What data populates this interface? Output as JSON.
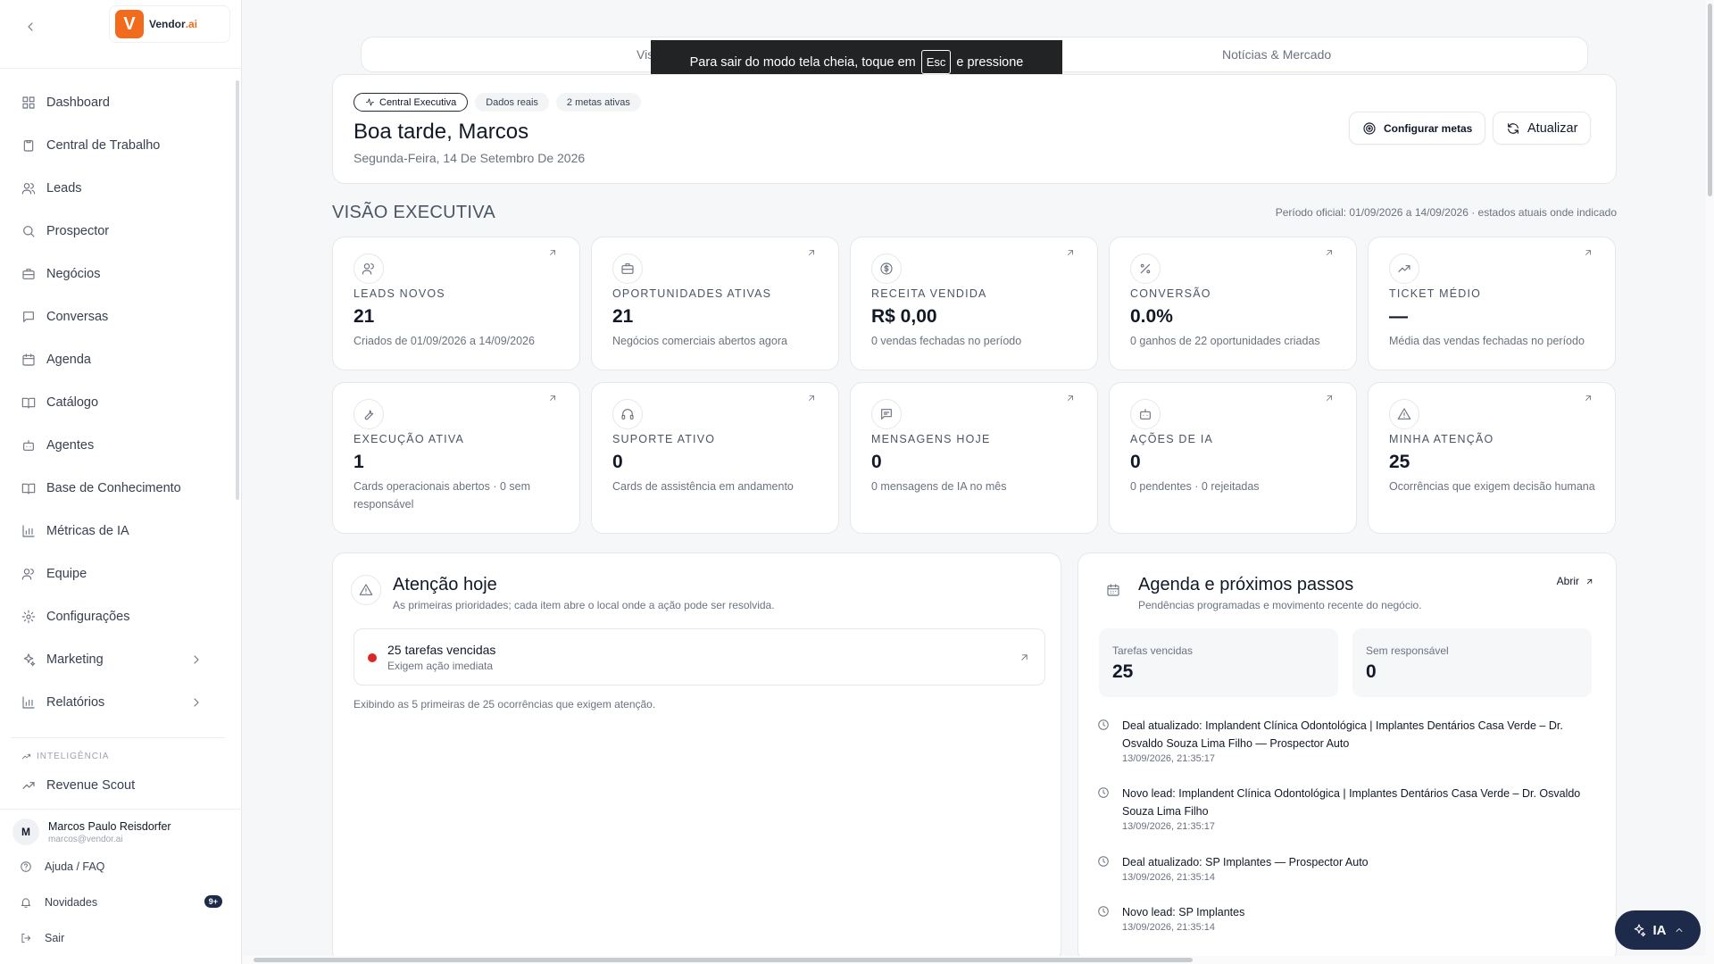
{
  "app": {
    "logo_letter": "V",
    "logo_name": "Vendor",
    "logo_suffix": ".ai",
    "accent": "#f26b1d",
    "dark": "#1e2a4a"
  },
  "sidebar": {
    "items": [
      {
        "label": "Dashboard",
        "icon": "grid-icon"
      },
      {
        "label": "Central de Trabalho",
        "icon": "clipboard-icon"
      },
      {
        "label": "Leads",
        "icon": "users-icon"
      },
      {
        "label": "Prospector",
        "icon": "search-icon"
      },
      {
        "label": "Negócios",
        "icon": "briefcase-icon"
      },
      {
        "label": "Conversas",
        "icon": "message-icon"
      },
      {
        "label": "Agenda",
        "icon": "calendar-icon"
      },
      {
        "label": "Catálogo",
        "icon": "book-icon"
      },
      {
        "label": "Agentes",
        "icon": "bot-icon"
      },
      {
        "label": "Base de Conhecimento",
        "icon": "book-open-icon"
      },
      {
        "label": "Métricas de IA",
        "icon": "bar-chart-icon"
      },
      {
        "label": "Equipe",
        "icon": "team-icon"
      },
      {
        "label": "Configurações",
        "icon": "gear-icon"
      },
      {
        "label": "Marketing",
        "icon": "sparkles-icon"
      },
      {
        "label": "Relatórios",
        "icon": "bar-chart-icon"
      }
    ],
    "section_label": "INTELIGÊNCIA",
    "revenue_scout": "Revenue Scout",
    "user": {
      "initial": "M",
      "name": "Marcos Paulo Reisdorfer",
      "email": "marcos@vendor.ai"
    },
    "help": "Ajuda / FAQ",
    "news": "Novidades",
    "news_badge": "9+",
    "logout": "Sair"
  },
  "tabs": {
    "first": "Visão",
    "second": "Notícias & Mercado"
  },
  "toast": {
    "before": "Para sair do modo tela cheia, toque em",
    "key": "Esc",
    "after": "e pressione"
  },
  "hero": {
    "chip_executive": "Central Executiva",
    "chip_data": "Dados reais",
    "chip_goals": "2 metas ativas",
    "greeting": "Boa tarde, Marcos",
    "date": "Segunda-Feira, 14 De Setembro De 2026",
    "configure_label": "Configurar metas",
    "refresh_label": "Atualizar"
  },
  "section": {
    "title": "VISÃO EXECUTIVA",
    "period": "Período oficial: 01/09/2026 a 14/09/2026 · estados atuais onde indicado"
  },
  "kpis": [
    {
      "label": "LEADS NOVOS",
      "value": "21",
      "desc": "Criados de 01/09/2026 a 14/09/2026",
      "icon": "users-icon"
    },
    {
      "label": "OPORTUNIDADES ATIVAS",
      "value": "21",
      "desc": "Negócios comerciais abertos agora",
      "icon": "briefcase-icon"
    },
    {
      "label": "RECEITA VENDIDA",
      "value": "R$ 0,00",
      "desc": "0 vendas fechadas no período",
      "icon": "dollar-icon"
    },
    {
      "label": "CONVERSÃO",
      "value": "0.0%",
      "desc": "0 ganhos de 22 oportunidades criadas",
      "icon": "percent-icon"
    },
    {
      "label": "TICKET MÉDIO",
      "value": "—",
      "desc": "Média das vendas fechadas no período",
      "icon": "trending-up-icon"
    },
    {
      "label": "EXECUÇÃO ATIVA",
      "value": "1",
      "desc": "Cards operacionais abertos · 0 sem responsável",
      "icon": "wrench-icon"
    },
    {
      "label": "SUPORTE ATIVO",
      "value": "0",
      "desc": "Cards de assistência em andamento",
      "icon": "headphones-icon"
    },
    {
      "label": "MENSAGENS HOJE",
      "value": "0",
      "desc": "0 mensagens de IA no mês",
      "icon": "message-square-icon"
    },
    {
      "label": "AÇÕES DE IA",
      "value": "0",
      "desc": "0 pendentes · 0 rejeitadas",
      "icon": "bot-icon"
    },
    {
      "label": "MINHA ATENÇÃO",
      "value": "25",
      "desc": "Ocorrências que exigem decisão humana",
      "icon": "alert-triangle-icon"
    }
  ],
  "attention": {
    "title": "Atenção hoje",
    "subtitle": "As primeiras prioridades; cada item abre o local onde a ação pode ser resolvida.",
    "item_title": "25 tarefas vencidas",
    "item_sub": "Exigem ação imediata",
    "footer": "Exibindo as 5 primeiras de 25 ocorrências que exigem atenção."
  },
  "agenda": {
    "title": "Agenda e próximos passos",
    "subtitle": "Pendências programadas e movimento recente do negócio.",
    "open_label": "Abrir",
    "stat1_label": "Tarefas vencidas",
    "stat1_value": "25",
    "stat2_label": "Sem responsável",
    "stat2_value": "0",
    "timeline": [
      {
        "text": "Deal atualizado: Implandent Clínica Odontológica | Implantes Dentários Casa Verde – Dr. Osvaldo Souza Lima Filho — Prospector Auto",
        "time": "13/09/2026, 21:35:17"
      },
      {
        "text": "Novo lead: Implandent Clínica Odontológica | Implantes Dentários Casa Verde – Dr. Osvaldo Souza Lima Filho",
        "time": "13/09/2026, 21:35:17"
      },
      {
        "text": "Deal atualizado: SP Implantes — Prospector Auto",
        "time": "13/09/2026, 21:35:14"
      },
      {
        "text": "Novo lead: SP Implantes",
        "time": "13/09/2026, 21:35:14"
      }
    ]
  },
  "ia_button": "IA"
}
